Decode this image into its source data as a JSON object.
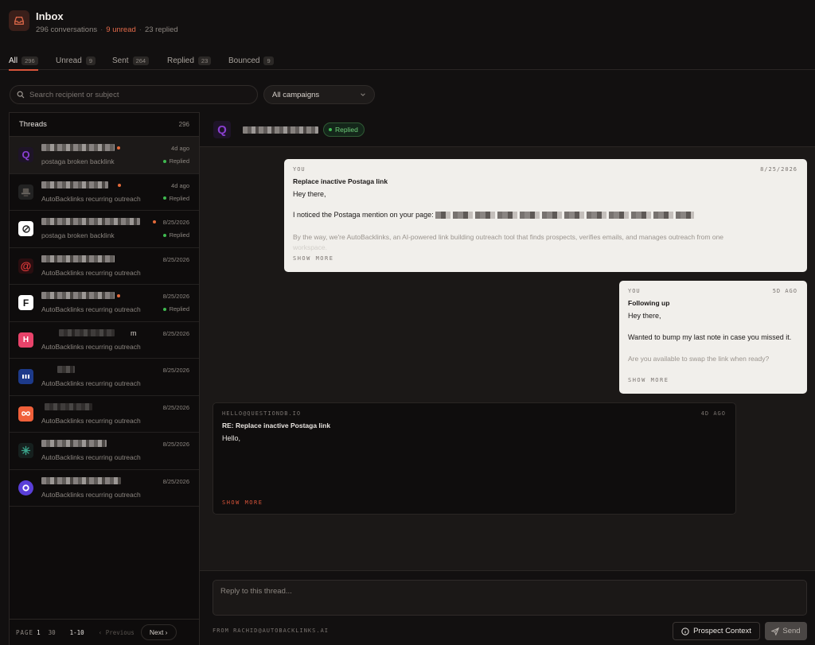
{
  "header": {
    "title": "Inbox",
    "conversations": "296 conversations",
    "unread": "9 unread",
    "replied": "23 replied"
  },
  "tabs": [
    {
      "label": "All",
      "count": "296"
    },
    {
      "label": "Unread",
      "count": "9"
    },
    {
      "label": "Sent",
      "count": "264"
    },
    {
      "label": "Replied",
      "count": "23"
    },
    {
      "label": "Bounced",
      "count": "9"
    }
  ],
  "search": {
    "placeholder": "Search recipient or subject"
  },
  "campaign_filter": {
    "selected": "All campaigns"
  },
  "threads": {
    "title": "Threads",
    "count": "296",
    "items": [
      {
        "subject": "postaga broken backlink",
        "date": "4d ago",
        "status": "Replied",
        "avatar": "Q"
      },
      {
        "subject": "AutoBacklinks recurring outreach",
        "date": "4d ago",
        "status": "Replied",
        "avatar": ""
      },
      {
        "subject": "postaga broken backlink",
        "date": "8/25/2026",
        "status": "Replied",
        "avatar": ""
      },
      {
        "subject": "AutoBacklinks recurring outreach",
        "date": "8/25/2026",
        "status": "",
        "avatar": "@"
      },
      {
        "subject": "AutoBacklinks recurring outreach",
        "date": "8/25/2026",
        "status": "Replied",
        "avatar": "F"
      },
      {
        "subject": "AutoBacklinks recurring outreach",
        "date": "8/25/2026",
        "status": "",
        "avatar": "H",
        "name_tail": "m"
      },
      {
        "subject": "AutoBacklinks recurring outreach",
        "date": "8/25/2026",
        "status": "",
        "avatar": ""
      },
      {
        "subject": "AutoBacklinks recurring outreach",
        "date": "8/25/2026",
        "status": "",
        "avatar": ""
      },
      {
        "subject": "AutoBacklinks recurring outreach",
        "date": "8/25/2026",
        "status": "",
        "avatar": ""
      },
      {
        "subject": "AutoBacklinks recurring outreach",
        "date": "8/25/2026",
        "status": "",
        "avatar": ""
      }
    ]
  },
  "pagination": {
    "page_label": "PAGE",
    "current": "1",
    "total": "30",
    "range": "1-10",
    "prev": "Previous",
    "next": "Next"
  },
  "conversation": {
    "avatar": "Q",
    "status": "Replied",
    "messages": [
      {
        "from": "YOU",
        "date": "8/25/2026",
        "subject": "Replace inactive Postaga link",
        "lines": [
          "Hey there,",
          "I noticed the Postaga mention on your page:",
          "By the way, we're AutoBacklinks, an AI-powered link building outreach tool that finds prospects, verifies emails, and manages outreach from one",
          "workspace."
        ],
        "more": "SHOW MORE"
      },
      {
        "from": "YOU",
        "date": "5D AGO",
        "subject": "Following up",
        "lines": [
          "Hey there,",
          "Wanted to bump my last note in case you missed it.",
          "Are you available to swap the link when ready?"
        ],
        "more": "SHOW MORE"
      },
      {
        "from": "HELLO@QUESTIONDB.IO",
        "date": "4D AGO",
        "subject": "RE: Replace inactive Postaga link",
        "lines": [
          "Hello,"
        ],
        "more": "SHOW MORE"
      }
    ]
  },
  "reply": {
    "placeholder": "Reply to this thread...",
    "from": "FROM RACHID@AUTOBACKLINKS.AI",
    "context_button": "Prospect Context",
    "send_button": "Send"
  }
}
